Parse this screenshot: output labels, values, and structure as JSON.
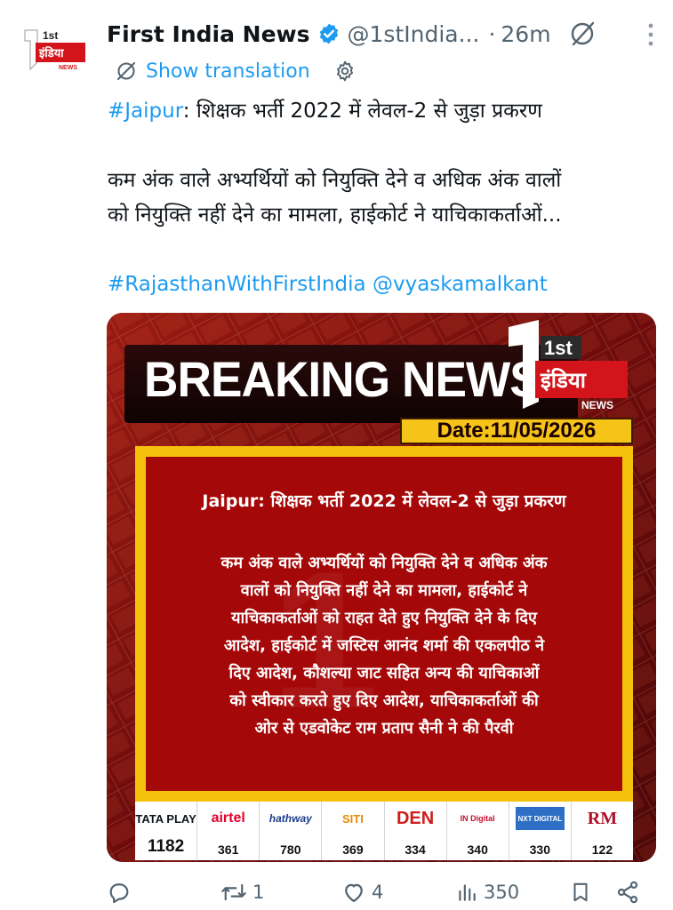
{
  "author": {
    "name": "First India News",
    "handle": "@1stIndia...",
    "time_separator": "·",
    "time": "26m",
    "avatar_logo": {
      "top": "1st",
      "middle": "इंडिया",
      "bottom": "NEWS"
    }
  },
  "translation": {
    "label": "Show translation"
  },
  "tweet": {
    "hashtag_location": "#Jaipur",
    "line1_rest": ": शिक्षक भर्ती 2022 में लेवल-2 से जुड़ा प्रकरण",
    "line2": "कम अंक वाले अभ्यर्थियों को नियुक्ति देने व अधिक अंक वालों",
    "line3": "को नियुक्ति नहीं देने का मामला, हाईकोर्ट ने याचिकाकर्ताओं...",
    "hashtag_campaign": "#RajasthanWithFirstIndia",
    "mention": "@vyaskamalkant"
  },
  "media": {
    "banner": "BREAKING NEWS",
    "logo": {
      "top": "1st",
      "middle": "इंडिया",
      "bottom": "NEWS"
    },
    "date": "Date:11/05/2026",
    "headline": "Jaipur: शिक्षक भर्ती 2022 में लेवल-2 से जुड़ा प्रकरण",
    "body_lines": [
      "कम अंक वाले अभ्यर्थियों को नियुक्ति देने व अधिक अंक",
      "वालों को नियुक्ति नहीं देने का मामला, हाईकोर्ट ने",
      "याचिकाकर्ताओं को राहत देते हुए नियुक्ति देने के दिए",
      "आदेश, हाईकोर्ट में जस्टिस आनंद शर्मा की एकलपीठ ने",
      "दिए आदेश, कौशल्या जाट सहित अन्य की याचिकाओं",
      "को स्वीकार करते हुए दिए आदेश, याचिकाकर्ताओं की",
      "ओर से एडवोकेट राम प्रताप सैनी ने की पैरवी"
    ],
    "channels": [
      {
        "name": "TATA PLAY",
        "number": "1182",
        "color": "#1a1a1a"
      },
      {
        "name": "airtel",
        "number": "361",
        "color": "#e4002b"
      },
      {
        "name": "hathway",
        "number": "780",
        "color": "#1b3d8f"
      },
      {
        "name": "SITI",
        "number": "369",
        "color": "#e88a00"
      },
      {
        "name": "DEN",
        "number": "334",
        "color": "#d01c1c"
      },
      {
        "name": "IN Digital",
        "number": "340",
        "color": "#c8102e"
      },
      {
        "name": "NXT DIGITAL",
        "number": "330",
        "color": "#2d6fc4"
      },
      {
        "name": "RM",
        "number": "122",
        "color": "#b0102a"
      }
    ]
  },
  "actions": {
    "reply_count": "",
    "repost_count": "1",
    "like_count": "4",
    "views_count": "350"
  },
  "colors": {
    "accent": "#1d9bf0",
    "muted": "#536471",
    "banner_red": "#a50808",
    "frame_yellow": "#f4c20d"
  }
}
